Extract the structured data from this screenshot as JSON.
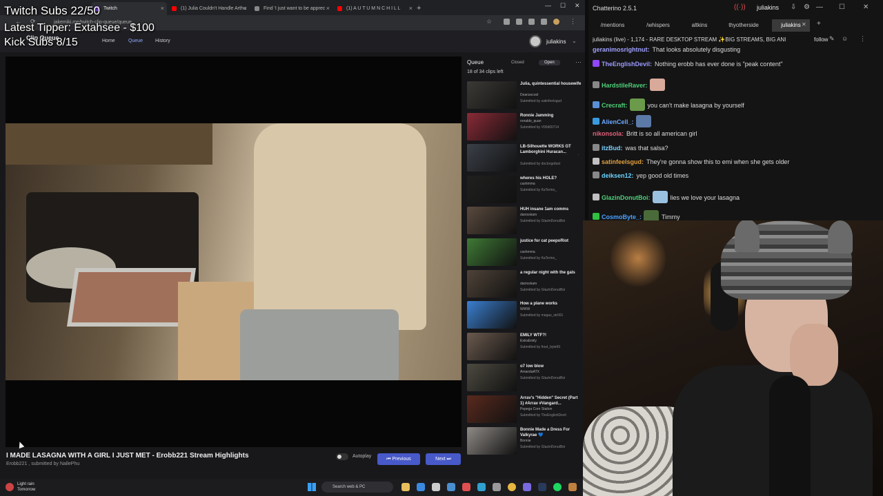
{
  "overlay": {
    "subs": "Twitch Subs 22/50",
    "tipper": "Latest Tipper: Extahsee - $100",
    "kick": "Kick Subs 8/15"
  },
  "browser": {
    "tabs": [
      {
        "label": "Twitch",
        "color": "#9146ff"
      },
      {
        "label": "(1) Julia Couldn't Handle Arthu",
        "color": "#ff0000"
      },
      {
        "label": "Find 'I just want to be apprec",
        "color": "#888888"
      },
      {
        "label": "(1) A U T U M N   C H I L L",
        "color": "#ff0000"
      }
    ],
    "new_tab": "+",
    "url": "jakemiki.me/twitch-clip-queue/queue",
    "app_name": "Clip Queue",
    "nav": [
      "Home",
      "Queue",
      "History"
    ],
    "user": "juliakins",
    "video_title": "I MADE LASAGNA WITH A GIRL I JUST MET - Erobb221 Stream Highlights",
    "video_meta": "Erobb221 , submitted by NallePhu",
    "autoplay": "Autoplay",
    "prev": "Previous",
    "next": "Next",
    "queue": {
      "title": "Queue",
      "closed": "Closed",
      "open": "Open",
      "count": "18 of 34 clips left",
      "items": [
        {
          "title": "Julia, quintessential housewife",
          "channel": "Deansocool",
          "sub": "Submitted by satinfeelsgud",
          "thumb": "#3c3a36"
        },
        {
          "title": "Ronnie Jamming",
          "channel": "ronaldo_quan",
          "sub": "Submitted by V00d00714",
          "thumb": "#8a2a36"
        },
        {
          "title": "LB-Silhouette WORKS GT Lamborghini Huracan... _LIBERTY WALK [リバティーウォーク]",
          "channel": "",
          "sub": "Submitted by doctorgofast",
          "thumb": "#3b4048"
        },
        {
          "title": "wheres his HOLE?",
          "channel": "cashmma",
          "sub": "Submitted by KaTerino_",
          "thumb": "#20201f"
        },
        {
          "title": "HUH insane 1am comms",
          "channel": "danioskam",
          "sub": "Submitted by GlazinDonutBoi",
          "thumb": "#5a4a3e"
        },
        {
          "title": "justice for cat peepoRiot",
          "channel": "cashmma",
          "sub": "Submitted by KaTerino_",
          "thumb": "#3f7a35"
        },
        {
          "title": "a regular night with the gals",
          "channel": "danioskam",
          "sub": "Submitted by GlazinDonutBoi",
          "thumb": "#4f4338"
        },
        {
          "title": "How a plane works",
          "channel": "WWW",
          "sub": "Submitted by megas_str001",
          "thumb": "#3a7fd0"
        },
        {
          "title": "EMILY WTF?!",
          "channel": "ExtraEmily",
          "sub": "Submitted by frost_byte69",
          "thumb": "#6b5a4e"
        },
        {
          "title": "o7 low blow",
          "channel": "AmandaATX",
          "sub": "Submitted by GlazinDonutBoi",
          "thumb": "#4d4a40"
        },
        {
          "title": "Arrav's \"Hidden\" Secret (Part 1) #Arrav #Vangard...",
          "channel": "Pepega Core Station",
          "sub": "Submitted by TheEnglishDevil",
          "thumb": "#5a2a1e"
        },
        {
          "title": "Bonnie Made a Dress For Valkyrae 💙",
          "channel": "Bonnie",
          "sub": "Submitted by GlazinDonutBoi",
          "thumb": "#8f8a86"
        }
      ]
    }
  },
  "chat": {
    "app_title": "Chatterino 2.5.1",
    "user": "juliakins",
    "tabs": [
      "/mentions",
      "/whispers",
      "altkins",
      "thyotherside",
      "juliakins"
    ],
    "channel_line": "juliakins (live) - 1,174 - RARE DESKTOP STREAM ✨BIG STREAMS, BIG ANI",
    "follow": "follow",
    "messages": [
      {
        "name": "geranimosrightnut:",
        "color": "#a0a0ff",
        "text": "That looks absolutely disgusting",
        "badge": "",
        "emote": ""
      },
      {
        "name": "TheEnglishDevil:",
        "color": "#9a9aff",
        "text": "Nothing erobb has ever done is \"peak content\"",
        "badge": "#9146ff",
        "emote": ""
      },
      {
        "name": "HardstileRaver:",
        "color": "#4fd07a",
        "text": "",
        "badge": "#888888",
        "emote": "#d9a99a"
      },
      {
        "name": "Crecraft:",
        "color": "#4fd07a",
        "text": "you can't make lasagna by yourself",
        "badge": "#5a8fd8",
        "emote": "#6a9a4a"
      },
      {
        "name": "AlienCell_:",
        "color": "#6aa8ff",
        "text": "",
        "badge": "#3a9ae0",
        "emote": "#5c7aa8"
      },
      {
        "name": "nikonsola:",
        "color": "#e0607a",
        "text": "Britt is so all american girl",
        "badge": "",
        "emote": ""
      },
      {
        "name": "itzBud:",
        "color": "#7ad0ff",
        "text": "was that salsa?",
        "badge": "#888888",
        "emote": ""
      },
      {
        "name": "satinfeelsgud:",
        "color": "#e0a040",
        "text": "They're gonna show this to emi when she gets older",
        "badge": "#c0c0c0",
        "emote": ""
      },
      {
        "name": "deiksen12:",
        "color": "#6ad4ff",
        "text": "yep good old times",
        "badge": "#888888",
        "emote": ""
      },
      {
        "name": "GlazinDonutBoi:",
        "color": "#4fd07a",
        "text": "lies we love your lasagna",
        "badge": "#c0c0c0",
        "emote": "#9ac0e0"
      },
      {
        "name": "CosmoByte_:",
        "color": "#4aa0ff",
        "text": "Timmy",
        "badge": "#30c040",
        "emote": "#4a6a3a"
      }
    ]
  },
  "taskbar": {
    "weather_1": "Light rain",
    "weather_2": "Tomorrow",
    "search": "Search web & PC"
  }
}
